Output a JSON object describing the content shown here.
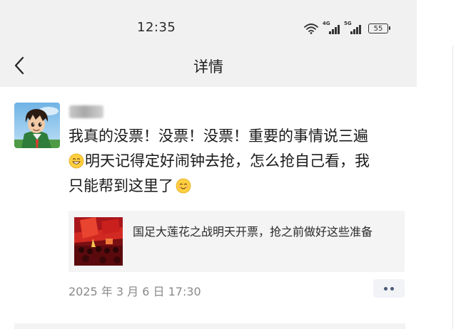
{
  "status_bar": {
    "time": "12:35",
    "network_1": "4G",
    "network_2": "5G",
    "battery": "55"
  },
  "nav": {
    "title": "详情"
  },
  "post": {
    "line_1": "我真的没票！没票！没票！重要的事情说三遍",
    "line_2": "明天记得定好闹钟去抢，怎么抢自己看，我",
    "line_3": "只能帮到这里了",
    "link_title": "国足大莲花之战明天开票，抢之前做好这些准备",
    "timestamp": "2025 年 3 月 6 日 17:30"
  },
  "icons": {
    "back": "chevron-left-icon",
    "wifi": "wifi-icon",
    "signal": "signal-icon",
    "battery": "battery-icon",
    "more": "more-dots-icon",
    "emoji_1": "grin-emoji-icon",
    "emoji_2": "smile-emoji-icon"
  },
  "colors": {
    "header_bg": "#f1f1f1",
    "link_card_bg": "#f4f4f4",
    "more_dots": "#4a5a78",
    "timestamp": "#8a8a8a"
  }
}
